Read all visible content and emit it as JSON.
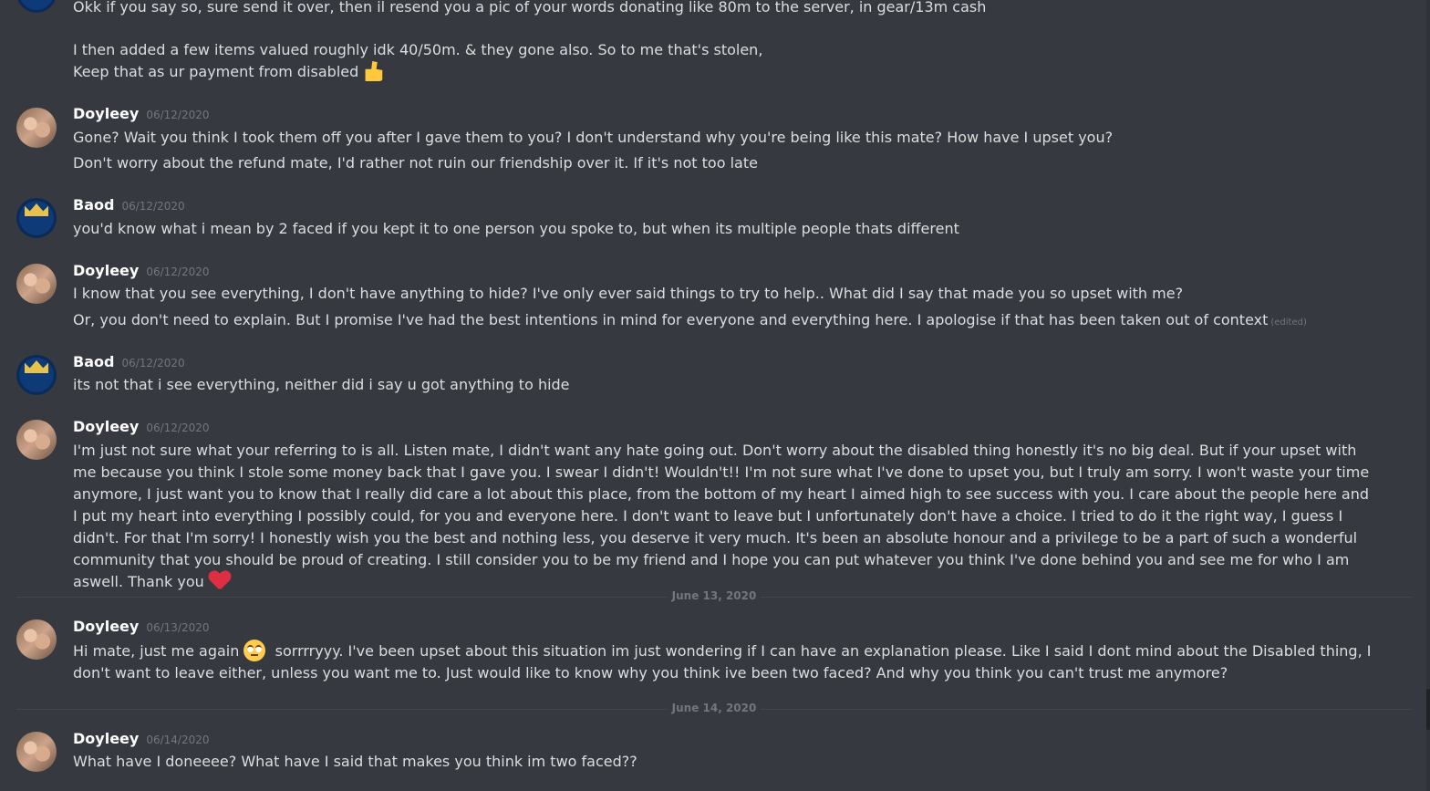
{
  "messages": [
    {
      "id": "m0",
      "lines": [
        "Okk if you say so, sure send it over, then il resend you a pic of your words donating like 80m to the server, in gear/13m cash",
        "I then added a few items valued roughly idk 40/50m. & they gone also. So to me that's stolen,",
        "Keep that as ur payment from disabled"
      ]
    },
    {
      "id": "m1",
      "author": "Doyleey",
      "date": "06/12/2020",
      "lines": [
        "Gone? Wait you think I took them off you after I gave them to you? I don't understand why you're being like this mate? How have I upset you?",
        "Don't worry about the refund mate, I'd rather not ruin our friendship over it. If it's not too late"
      ]
    },
    {
      "id": "m2",
      "author": "Baod",
      "date": "06/12/2020",
      "lines": [
        "you'd know what i mean by 2 faced if you kept it to one person you spoke to, but when its multiple people thats different"
      ]
    },
    {
      "id": "m3",
      "author": "Doyleey",
      "date": "06/12/2020",
      "lines": [
        "I know that you see everything, I don't have anything to hide? I've only ever said things to try to help.. What did I say that made you so upset with me?",
        "Or, you don't need to explain. But I promise I've had the best intentions in mind for everyone and everything here. I apologise if that has been taken out of context"
      ],
      "edited": "(edited)"
    },
    {
      "id": "m4",
      "author": "Baod",
      "date": "06/12/2020",
      "lines": [
        "its not that i see everything, neither did i say u got anything to hide"
      ]
    },
    {
      "id": "m5",
      "author": "Doyleey",
      "date": "06/12/2020",
      "lines": [
        "I'm just not sure what your referring to is all. Listen mate, I didn't want any hate going out. Don't worry about the disabled thing honestly it's no big deal. But if your upset with me because you think I stole some money back that I gave you. I swear I didn't! Wouldn't!! I'm not sure what I've done to upset you, but I truly am sorry. I won't waste your time anymore, I just want you to know that I really did care a lot about this place, from the bottom of my heart I aimed high to see success with you. I care about the people here and I put my heart into everything I possibly could, for you and everyone here. I don't want to leave but I unfortunately don't have a choice. I tried to do it the right way, I guess I didn't. For that I'm sorry! I honestly wish you the best and nothing less, you deserve it very much. It's been an absolute honour and a privilege to be a part of such a wonderful community that you should be proud of creating. I still consider you to be my friend and I hope you can put whatever you think I've done behind you and see me for who I am aswell. Thank you"
      ]
    },
    {
      "id": "m6",
      "author": "Doyleey",
      "date": "06/13/2020",
      "lines": [
        "Hi mate, just me again",
        "sorrrryyy. I've been upset about this situation im just wondering if I can have an explanation please. Like I said I dont mind about the Disabled thing, I don't want to leave either, unless you want me to. Just would like to know why you think ive been two faced? And why you think you can't trust me anymore?"
      ]
    },
    {
      "id": "m7",
      "author": "Doyleey",
      "date": "06/14/2020",
      "lines": [
        "What have I doneeee? What have I said that makes you think im two faced??"
      ]
    }
  ],
  "dividers": [
    "June 13, 2020",
    "June 14, 2020"
  ],
  "icons": {
    "thumbs": "thumbs-up-emoji",
    "heart": "red-heart-emoji",
    "eyeroll": "face-with-rolling-eyes-emoji"
  },
  "colors": {
    "background": "#36393f",
    "text": "#dcddde",
    "username": "#ffffff",
    "muted": "#72767d"
  }
}
